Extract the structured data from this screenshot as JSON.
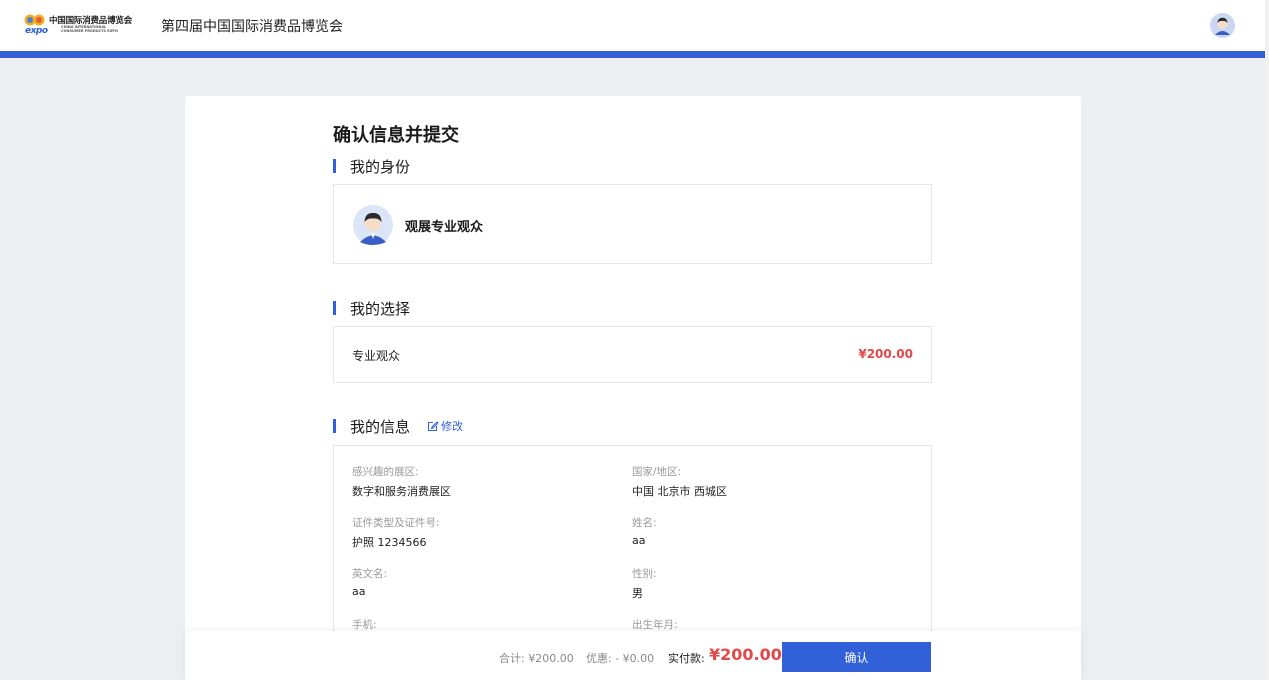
{
  "header": {
    "logo_cn": "中国国际消费品博览会",
    "logo_en_line1": "CHINA INTERNATIONAL",
    "logo_en_line2": "CONSUMER PRODUCTS EXPO",
    "logo_expo": "expo",
    "site_title": "第四届中国国际消费品博览会",
    "avatar_icon": "user-avatar-icon"
  },
  "progress": {
    "percent": 100,
    "color": "#3160d8"
  },
  "page": {
    "title": "确认信息并提交"
  },
  "identity": {
    "section_label": "我的身份",
    "role_label": "观展专业观众",
    "avatar_icon": "male-avatar-icon"
  },
  "choice": {
    "section_label": "我的选择",
    "item_name": "专业观众",
    "item_price": "¥200.00"
  },
  "info": {
    "section_label": "我的信息",
    "edit_label": "修改",
    "fields": [
      {
        "label": "感兴趣的展区:",
        "value": "数字和服务消费展区"
      },
      {
        "label": "国家/地区:",
        "value": "中国 北京市 西城区"
      },
      {
        "label": "证件类型及证件号:",
        "value": "护照 1234566"
      },
      {
        "label": "姓名:",
        "value": "aa"
      },
      {
        "label": "英文名:",
        "value": "aa"
      },
      {
        "label": "性别:",
        "value": "男"
      },
      {
        "label": "手机:",
        "value": ""
      },
      {
        "label": "出生年月:",
        "value": ""
      }
    ]
  },
  "footer": {
    "total_text": "合计: ¥200.00",
    "discount_text": "优惠: - ¥0.00",
    "pay_label": "实付款:",
    "pay_amount": "¥200.00",
    "confirm_label": "确认"
  },
  "colors": {
    "accent": "#3160d8",
    "price": "#e24848"
  }
}
